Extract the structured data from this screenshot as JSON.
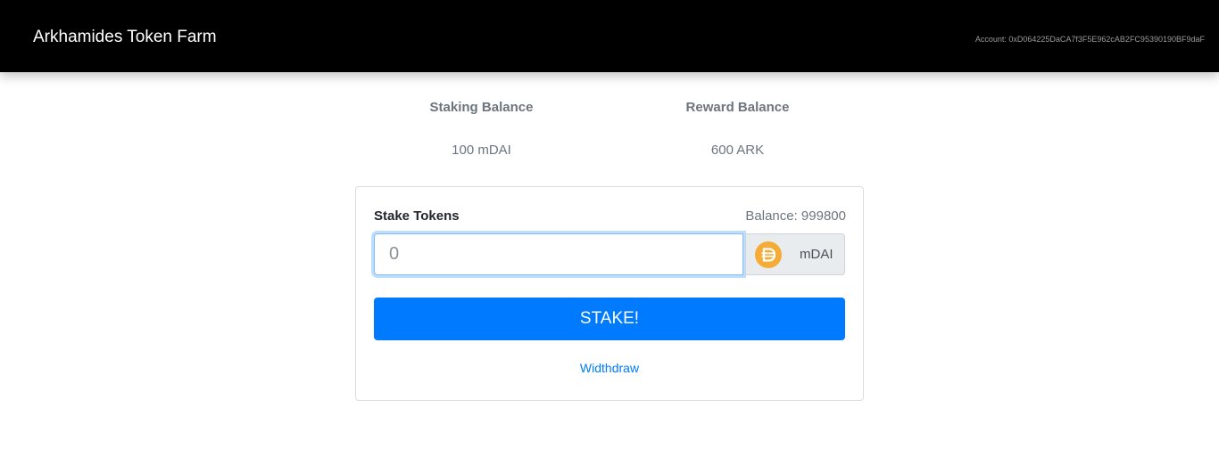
{
  "navbar": {
    "brand": "Arkhamides Token Farm",
    "account": "Account: 0xD064225DaCA7f3F5E962cAB2FC95390190BF9daF"
  },
  "balances": {
    "staking_header": "Staking Balance",
    "reward_header": "Reward Balance",
    "staking_value": "100 mDAI",
    "reward_value": "600 ARK"
  },
  "stake_form": {
    "title": "Stake Tokens",
    "balance": "Balance: 999800",
    "input_placeholder": "0",
    "input_value": "",
    "token_icon": "dai-icon",
    "token_label": "mDAI",
    "stake_button": "STAKE!",
    "withdraw_link": "Widthdraw"
  },
  "colors": {
    "navbar_bg": "#000000",
    "primary": "#007bff",
    "dai_orange": "#f5ac37"
  }
}
